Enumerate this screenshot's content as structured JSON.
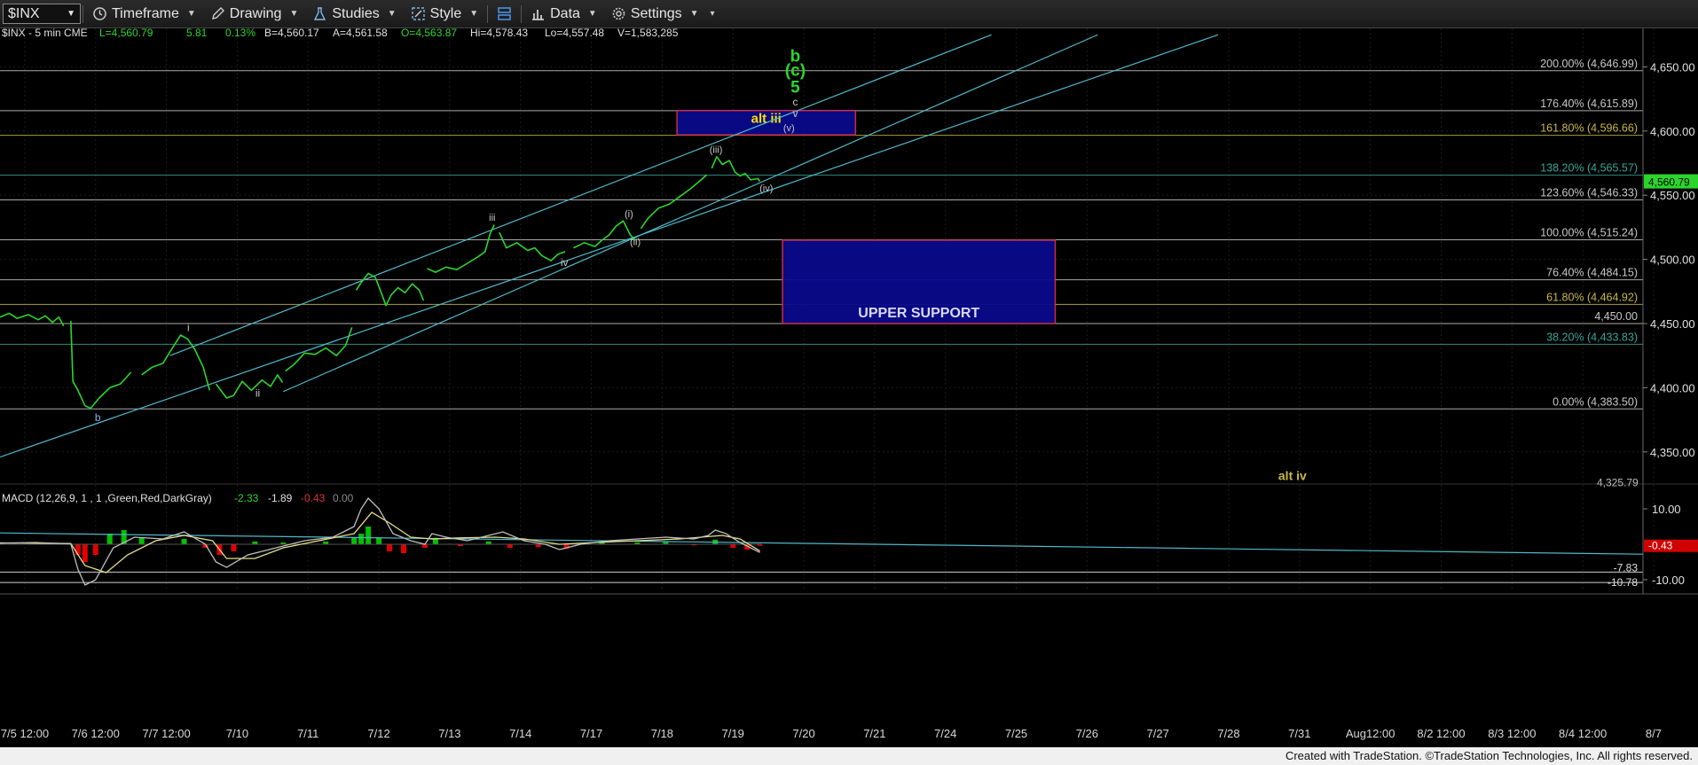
{
  "toolbar": {
    "symbol": "$INX",
    "timeframe": "Timeframe",
    "drawing": "Drawing",
    "studies": "Studies",
    "style": "Style",
    "data": "Data",
    "settings": "Settings"
  },
  "header": {
    "symbol_info": "$INX - 5 min  CME",
    "last": "L=4,560.79",
    "change": "5.81",
    "change_pct": "0.13%",
    "bid": "B=4,560.17",
    "ask": "A=4,561.58",
    "open": "O=4,563.87",
    "high": "Hi=4,578.43",
    "low": "Lo=4,557.48",
    "volume": "V=1,583,285"
  },
  "macd_header": {
    "title": "MACD (12,26,9, 1 , 1 ,Green,Red,DarkGray)",
    "v1": "-2.33",
    "v2": "-1.89",
    "v3": "-0.43",
    "v4": "0.00"
  },
  "footer": "Created with TradeStation. ©TradeStation Technologies, Inc. All rights reserved.",
  "colors": {
    "price": "#2bd62b",
    "channel": "#4fb9c9",
    "fib_white": "#c8c8c8",
    "fib_gold": "#c8b84a",
    "fib_teal": "#3aa59a",
    "box_fill": "#0a0a8c",
    "box_border": "#d0304a",
    "wave_green": "#2bd62b",
    "macd_pos": "#00c000",
    "macd_neg": "#e00000"
  },
  "chart_data": {
    "type": "line",
    "symbol": "$INX",
    "interval": "5 min",
    "y_axis": {
      "ylim": [
        4325,
        4680
      ],
      "ticks": [
        {
          "value": 4650,
          "label": "4,650.00"
        },
        {
          "value": 4600,
          "label": "4,600.00"
        },
        {
          "value": 4550,
          "label": "4,550.00"
        },
        {
          "value": 4500,
          "label": "4,500.00"
        },
        {
          "value": 4450,
          "label": "4,450.00"
        },
        {
          "value": 4400,
          "label": "4,400.00"
        },
        {
          "value": 4350,
          "label": "4,350.00"
        }
      ],
      "last_price_label": "4,560.79",
      "last_price": 4560.79,
      "partial_label": "4,325.79"
    },
    "x_axis": {
      "session_labels": [
        "7/5 12:00",
        "7/6 12:00",
        "7/7 12:00",
        "7/10",
        "7/11",
        "7/12",
        "7/13",
        "7/14",
        "7/17",
        "7/18",
        "7/19",
        "7/20",
        "7/21",
        "7/24",
        "7/25",
        "7/26",
        "7/27",
        "7/28",
        "7/31",
        "Aug12:00",
        "8/2 12:00",
        "8/3 12:00",
        "8/4 12:00",
        "8/7"
      ],
      "session_count": 23.2
    },
    "series": [
      {
        "points": [
          [
            0,
            4455
          ],
          [
            0.13,
            4458
          ],
          [
            0.24,
            4454
          ],
          [
            0.4,
            4457
          ],
          [
            0.54,
            4453
          ],
          [
            0.64,
            4456
          ],
          [
            0.74,
            4451
          ],
          [
            0.83,
            4455
          ],
          [
            0.9,
            4448
          ],
          [
            1.0,
            4452
          ],
          [
            1.03,
            4405
          ],
          [
            1.1,
            4398
          ],
          [
            1.2,
            4386
          ],
          [
            1.28,
            4384
          ],
          [
            1.4,
            4392
          ],
          [
            1.55,
            4400
          ],
          [
            1.7,
            4403
          ],
          [
            1.85,
            4412
          ],
          [
            2.0,
            4410
          ],
          [
            2.15,
            4416
          ],
          [
            2.3,
            4419
          ],
          [
            2.4,
            4428
          ],
          [
            2.55,
            4441
          ],
          [
            2.65,
            4438
          ],
          [
            2.75,
            4430
          ],
          [
            2.87,
            4416
          ],
          [
            2.96,
            4398
          ],
          [
            3.05,
            4403
          ],
          [
            3.2,
            4392
          ],
          [
            3.3,
            4394
          ],
          [
            3.42,
            4405
          ],
          [
            3.55,
            4398
          ],
          [
            3.7,
            4406
          ],
          [
            3.82,
            4401
          ],
          [
            3.92,
            4410
          ],
          [
            3.99,
            4404
          ],
          [
            4.03,
            4413
          ],
          [
            4.15,
            4418
          ],
          [
            4.3,
            4427
          ],
          [
            4.45,
            4426
          ],
          [
            4.6,
            4431
          ],
          [
            4.75,
            4425
          ],
          [
            4.88,
            4433
          ],
          [
            4.97,
            4447
          ],
          [
            5.03,
            4476
          ],
          [
            5.1,
            4482
          ],
          [
            5.2,
            4489
          ],
          [
            5.3,
            4486
          ],
          [
            5.37,
            4476
          ],
          [
            5.45,
            4464
          ],
          [
            5.52,
            4472
          ],
          [
            5.62,
            4478
          ],
          [
            5.72,
            4474
          ],
          [
            5.82,
            4481
          ],
          [
            5.92,
            4476
          ],
          [
            5.98,
            4468
          ],
          [
            6.03,
            4493
          ],
          [
            6.15,
            4490
          ],
          [
            6.3,
            4494
          ],
          [
            6.45,
            4492
          ],
          [
            6.6,
            4497
          ],
          [
            6.75,
            4502
          ],
          [
            6.85,
            4506
          ],
          [
            6.92,
            4520
          ],
          [
            6.98,
            4527
          ],
          [
            7.05,
            4521
          ],
          [
            7.15,
            4509
          ],
          [
            7.3,
            4513
          ],
          [
            7.45,
            4507
          ],
          [
            7.55,
            4509
          ],
          [
            7.65,
            4503
          ],
          [
            7.78,
            4499
          ],
          [
            7.88,
            4504
          ],
          [
            7.98,
            4506
          ],
          [
            8.1,
            4509
          ],
          [
            8.25,
            4513
          ],
          [
            8.4,
            4510
          ],
          [
            8.5,
            4515
          ],
          [
            8.6,
            4519
          ],
          [
            8.7,
            4526
          ],
          [
            8.8,
            4530
          ],
          [
            8.9,
            4519
          ],
          [
            8.97,
            4515
          ],
          [
            9.05,
            4524
          ],
          [
            9.15,
            4532
          ],
          [
            9.3,
            4540
          ],
          [
            9.45,
            4543
          ],
          [
            9.6,
            4549
          ],
          [
            9.75,
            4555
          ],
          [
            9.9,
            4562
          ],
          [
            9.98,
            4566
          ],
          [
            10.05,
            4571
          ],
          [
            10.12,
            4580
          ],
          [
            10.2,
            4574
          ],
          [
            10.3,
            4577
          ],
          [
            10.38,
            4568
          ],
          [
            10.45,
            4565
          ],
          [
            10.52,
            4567
          ],
          [
            10.6,
            4562
          ],
          [
            10.7,
            4563
          ],
          [
            10.73,
            4560.79
          ]
        ]
      }
    ],
    "fib_levels": [
      {
        "value": 4646.99,
        "label": "200.00% (4,646.99)",
        "color": "white"
      },
      {
        "value": 4615.89,
        "label": "176.40% (4,615.89)",
        "color": "white"
      },
      {
        "value": 4596.66,
        "label": "161.80% (4,596.66)",
        "color": "gold"
      },
      {
        "value": 4565.57,
        "label": "138.20% (4,565.57)",
        "color": "teal"
      },
      {
        "value": 4546.33,
        "label": "123.60% (4,546.33)",
        "color": "white"
      },
      {
        "value": 4515.24,
        "label": "100.00% (4,515.24)",
        "color": "white"
      },
      {
        "value": 4484.15,
        "label": "76.40% (4,484.15)",
        "color": "white"
      },
      {
        "value": 4464.92,
        "label": "61.80% (4,464.92)",
        "color": "gold"
      },
      {
        "value": 4450.0,
        "label": "4,450.00",
        "color": "white"
      },
      {
        "value": 4433.83,
        "label": "38.20% (4,433.83)",
        "color": "teal"
      },
      {
        "value": 4383.5,
        "label": "0.00% (4,383.50)",
        "color": "white"
      }
    ],
    "channel": {
      "lines": [
        [
          [
            2.4,
            4425
          ],
          [
            14.0,
            4675
          ]
        ],
        [
          [
            4.0,
            4397
          ],
          [
            15.5,
            4675
          ]
        ],
        [
          [
            0.0,
            4346
          ],
          [
            17.2,
            4675
          ]
        ]
      ]
    },
    "boxes": [
      {
        "label": "alt iii",
        "x0": 9.56,
        "x1": 12.08,
        "y0": 4597,
        "y1": 4616
      },
      {
        "label": "UPPER SUPPORT",
        "x0": 11.05,
        "x1": 14.9,
        "y0": 4450,
        "y1": 4515
      }
    ],
    "annotations": [
      {
        "text": "b",
        "x": 1.38,
        "y": 4374,
        "color": "blue"
      },
      {
        "text": "i",
        "x": 2.66,
        "y": 4444,
        "color": "white"
      },
      {
        "text": "ii",
        "x": 3.64,
        "y": 4393,
        "color": "white"
      },
      {
        "text": "iii",
        "x": 6.95,
        "y": 4530,
        "color": "white"
      },
      {
        "text": "iv",
        "x": 7.97,
        "y": 4495,
        "color": "white"
      },
      {
        "text": "(i)",
        "x": 8.88,
        "y": 4533,
        "color": "white"
      },
      {
        "text": "(ii)",
        "x": 8.97,
        "y": 4511,
        "color": "white"
      },
      {
        "text": "(iii)",
        "x": 10.11,
        "y": 4583,
        "color": "white"
      },
      {
        "text": "(iv)",
        "x": 10.82,
        "y": 4553,
        "color": "white"
      },
      {
        "text": "(v)",
        "x": 11.14,
        "y": 4600,
        "color": "white"
      },
      {
        "text": "v",
        "x": 11.23,
        "y": 4611,
        "color": "white"
      },
      {
        "text": "c",
        "x": 11.23,
        "y": 4620,
        "color": "white"
      },
      {
        "text": "5",
        "x": 11.23,
        "y": 4630,
        "color": "green"
      },
      {
        "text": "(c)",
        "x": 11.23,
        "y": 4643,
        "color": "green"
      },
      {
        "text": "b",
        "x": 11.23,
        "y": 4654,
        "color": "green"
      },
      {
        "text": "alt iv",
        "x": 18.25,
        "y": 4328,
        "color": "gold"
      }
    ]
  },
  "macd_data": {
    "ylim": [
      -12.5,
      15
    ],
    "ticks": [
      {
        "value": 10,
        "label": "10.00"
      },
      {
        "value": -10,
        "label": "-10.00"
      }
    ],
    "level_labels": [
      {
        "value": -7.83,
        "label": "-7.83"
      },
      {
        "value": -10.78,
        "label": "-10.78"
      }
    ],
    "current_label": "-0.43",
    "trendline": [
      [
        0,
        3.2
      ],
      [
        23.2,
        -2.8
      ]
    ],
    "hlines": [
      -7.83,
      -10.78
    ],
    "macd": [
      [
        0,
        0.3
      ],
      [
        0.5,
        0.5
      ],
      [
        1.0,
        0.1
      ],
      [
        1.1,
        -7
      ],
      [
        1.2,
        -11.5
      ],
      [
        1.35,
        -10
      ],
      [
        1.6,
        -1
      ],
      [
        1.9,
        2
      ],
      [
        2.3,
        1.5
      ],
      [
        2.6,
        3.5
      ],
      [
        2.9,
        0
      ],
      [
        3.05,
        -5
      ],
      [
        3.2,
        -6.5
      ],
      [
        3.5,
        -3
      ],
      [
        3.9,
        -1
      ],
      [
        4.3,
        1
      ],
      [
        4.7,
        2
      ],
      [
        5.0,
        5
      ],
      [
        5.1,
        10
      ],
      [
        5.2,
        13
      ],
      [
        5.35,
        10
      ],
      [
        5.55,
        3
      ],
      [
        5.8,
        1
      ],
      [
        6.0,
        0
      ],
      [
        6.1,
        3
      ],
      [
        6.3,
        2
      ],
      [
        6.6,
        1
      ],
      [
        6.9,
        2.5
      ],
      [
        7.1,
        3.5
      ],
      [
        7.4,
        1
      ],
      [
        7.7,
        0
      ],
      [
        7.9,
        -1.5
      ],
      [
        8.2,
        0
      ],
      [
        8.6,
        1
      ],
      [
        9.0,
        1.5
      ],
      [
        9.4,
        2
      ],
      [
        9.8,
        1.5
      ],
      [
        10.0,
        2.5
      ],
      [
        10.1,
        4
      ],
      [
        10.25,
        3
      ],
      [
        10.45,
        0.5
      ],
      [
        10.73,
        -2.33
      ]
    ],
    "signal": [
      [
        0,
        0.4
      ],
      [
        1.0,
        0.2
      ],
      [
        1.2,
        -6
      ],
      [
        1.5,
        -8
      ],
      [
        1.8,
        -3
      ],
      [
        2.2,
        1
      ],
      [
        2.6,
        2.5
      ],
      [
        3.0,
        1
      ],
      [
        3.2,
        -4
      ],
      [
        3.6,
        -4
      ],
      [
        4.0,
        -1
      ],
      [
        4.5,
        1
      ],
      [
        5.0,
        3
      ],
      [
        5.25,
        9
      ],
      [
        5.5,
        6
      ],
      [
        5.8,
        2
      ],
      [
        6.1,
        1.5
      ],
      [
        6.5,
        1.8
      ],
      [
        7.0,
        2
      ],
      [
        7.4,
        1.5
      ],
      [
        7.9,
        0
      ],
      [
        8.4,
        0.5
      ],
      [
        9.0,
        1
      ],
      [
        9.6,
        1.5
      ],
      [
        10.2,
        2.5
      ],
      [
        10.45,
        1.5
      ],
      [
        10.73,
        -1.89
      ]
    ],
    "histogram": [
      [
        0.2,
        0.2
      ],
      [
        0.6,
        0.3
      ],
      [
        1.1,
        -3
      ],
      [
        1.2,
        -5
      ],
      [
        1.35,
        -3
      ],
      [
        1.55,
        3
      ],
      [
        1.75,
        4
      ],
      [
        2.0,
        2
      ],
      [
        2.6,
        1.5
      ],
      [
        2.9,
        -1
      ],
      [
        3.1,
        -3
      ],
      [
        3.3,
        -2
      ],
      [
        3.6,
        0.8
      ],
      [
        4.0,
        0.5
      ],
      [
        4.6,
        0.8
      ],
      [
        5.0,
        2
      ],
      [
        5.1,
        3
      ],
      [
        5.2,
        5
      ],
      [
        5.35,
        2
      ],
      [
        5.5,
        -2
      ],
      [
        5.7,
        -2.5
      ],
      [
        6.0,
        -1
      ],
      [
        6.15,
        1.8
      ],
      [
        6.5,
        -0.5
      ],
      [
        6.9,
        0.8
      ],
      [
        7.2,
        -1
      ],
      [
        7.6,
        -0.8
      ],
      [
        8.0,
        -1.2
      ],
      [
        8.5,
        0.5
      ],
      [
        9.0,
        0.5
      ],
      [
        9.4,
        0.6
      ],
      [
        9.8,
        -0.3
      ],
      [
        10.1,
        1.3
      ],
      [
        10.35,
        -1
      ],
      [
        10.55,
        -1.5
      ],
      [
        10.73,
        -0.43
      ]
    ]
  }
}
